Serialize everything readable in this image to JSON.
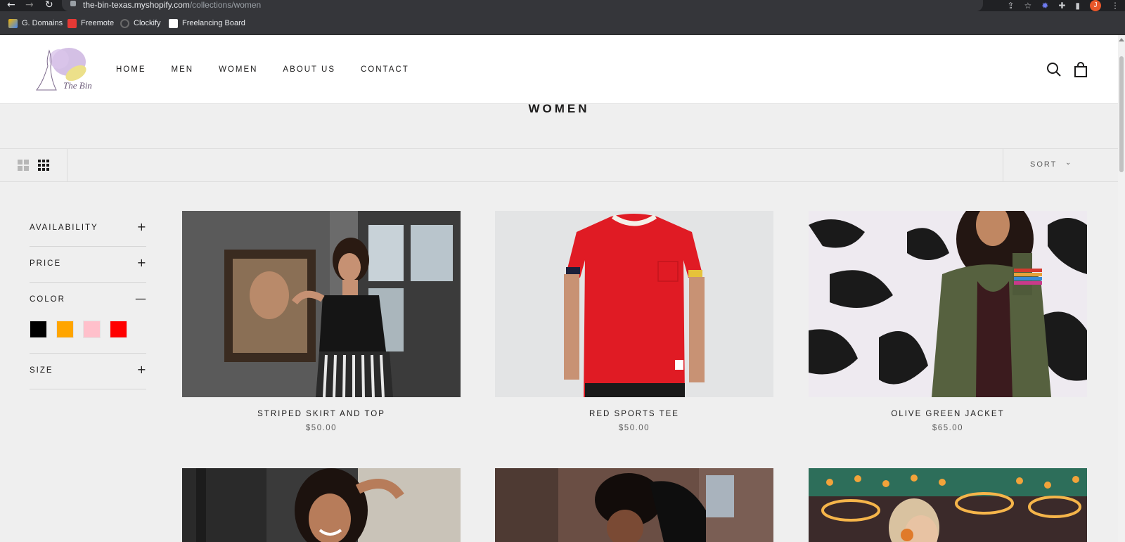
{
  "browser": {
    "url_host": "the-bin-texas.myshopify.com",
    "url_path": "/collections/women",
    "profile_initial": "J",
    "bookmarks": [
      {
        "label": "G. Domains",
        "icon_color": "#f4b400"
      },
      {
        "label": "Freemote",
        "icon_color": "#e53935"
      },
      {
        "label": "Clockify",
        "icon_color": "#5a5a5a"
      },
      {
        "label": "Freelancing Board",
        "icon_color": "#ffffff"
      }
    ]
  },
  "header": {
    "logo_text": "The Bin",
    "nav": [
      "HOME",
      "MEN",
      "WOMEN",
      "ABOUT US",
      "CONTACT"
    ]
  },
  "collection": {
    "title": "WOMEN",
    "sort_label": "SORT"
  },
  "filters": [
    {
      "label": "AVAILABILITY",
      "toggle": "+"
    },
    {
      "label": "PRICE",
      "toggle": "+"
    },
    {
      "label": "COLOR",
      "toggle": "—"
    },
    {
      "label": "SIZE",
      "toggle": "+"
    }
  ],
  "colors": [
    {
      "name": "black",
      "hex": "#000000"
    },
    {
      "name": "orange",
      "hex": "#ffa500"
    },
    {
      "name": "pink",
      "hex": "#ffc0cb"
    },
    {
      "name": "red",
      "hex": "#ff0000"
    }
  ],
  "products": [
    {
      "title": "STRIPED SKIRT AND TOP",
      "price": "$50.00"
    },
    {
      "title": "RED SPORTS TEE",
      "price": "$50.00"
    },
    {
      "title": "OLIVE GREEN JACKET",
      "price": "$65.00"
    }
  ]
}
